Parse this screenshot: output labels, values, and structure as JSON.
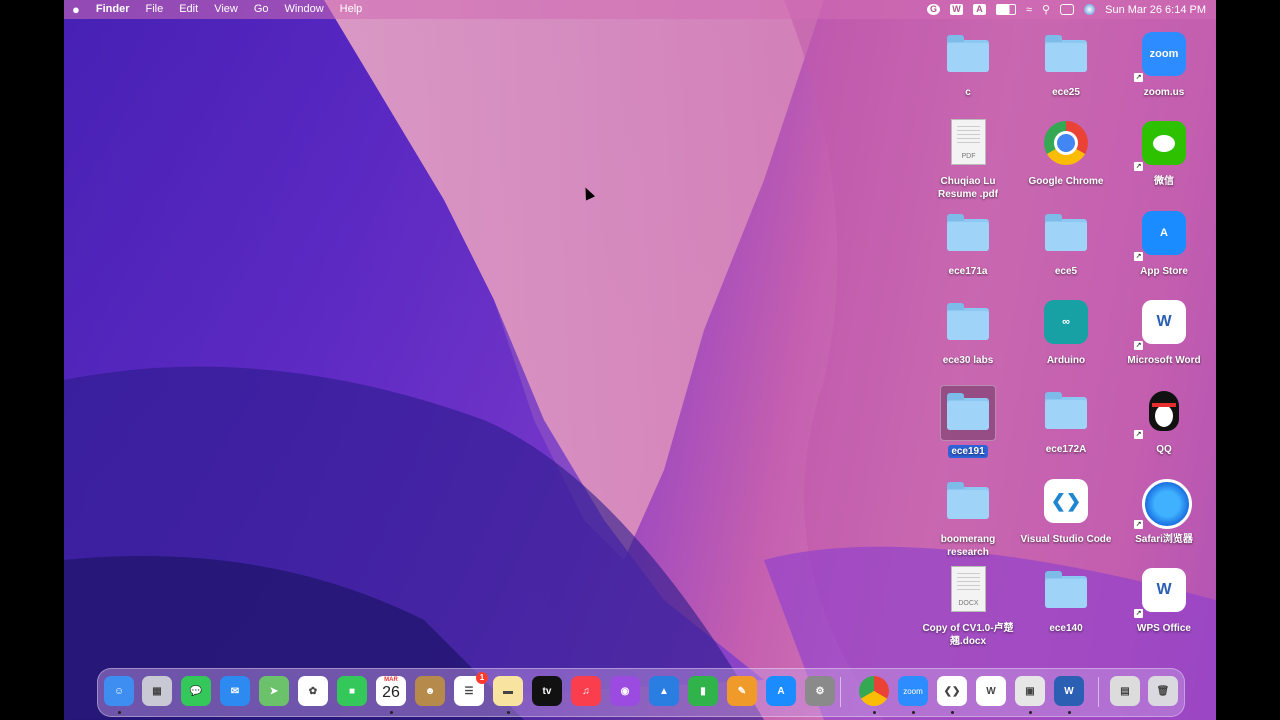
{
  "menubar": {
    "apple": "",
    "app": "Finder",
    "menus": [
      "File",
      "Edit",
      "View",
      "Go",
      "Window",
      "Help"
    ],
    "clock": "Sun Mar 26  6:14 PM"
  },
  "desktop": {
    "items": [
      {
        "label": "c",
        "kind": "folder"
      },
      {
        "label": "ece25",
        "kind": "folder"
      },
      {
        "label": "zoom.us",
        "kind": "app",
        "icon_text": "zoom",
        "color": "#2d8cff"
      },
      {
        "label": "Chuqiao Lu Resume .pdf",
        "kind": "doc",
        "ext": "PDF"
      },
      {
        "label": "Google Chrome",
        "kind": "app",
        "icon_text": "",
        "color": "#ffffff"
      },
      {
        "label": "微信",
        "kind": "app",
        "icon_text": "",
        "color": "#2dc100"
      },
      {
        "label": "ece171a",
        "kind": "folder"
      },
      {
        "label": "ece5",
        "kind": "folder"
      },
      {
        "label": "App Store",
        "kind": "app",
        "icon_text": "A",
        "color": "#1a8cff"
      },
      {
        "label": "ece30 labs",
        "kind": "folder"
      },
      {
        "label": "Arduino",
        "kind": "app",
        "icon_text": "∞",
        "color": "#17a1a5"
      },
      {
        "label": "Microsoft Word",
        "kind": "app",
        "icon_text": "W",
        "color": "#ffffff"
      },
      {
        "label": "ece191",
        "kind": "folder",
        "selected": true
      },
      {
        "label": "ece172A",
        "kind": "folder"
      },
      {
        "label": "QQ",
        "kind": "app",
        "icon_text": "",
        "color": "transparent"
      },
      {
        "label": "boomerang research",
        "kind": "folder"
      },
      {
        "label": "Visual Studio Code",
        "kind": "app",
        "icon_text": "",
        "color": "#ffffff"
      },
      {
        "label": "Safari浏览器",
        "kind": "app",
        "icon_text": "",
        "color": "#ffffff"
      },
      {
        "label": "Copy of CV1.0-卢楚翘.docx",
        "kind": "doc",
        "ext": "DOCX"
      },
      {
        "label": "ece140",
        "kind": "folder"
      },
      {
        "label": "WPS Office",
        "kind": "app",
        "icon_text": "W",
        "color": "#ffffff"
      }
    ]
  },
  "dock": {
    "calendar_month": "MAR",
    "calendar_day": "26",
    "reminders_badge": "1",
    "tv_label": "tv",
    "zoom_label": "zoom",
    "items": [
      {
        "name": "finder",
        "color": "#3d8ef0",
        "glyph": "☺",
        "running": true
      },
      {
        "name": "launchpad",
        "color": "#c9c9d6",
        "glyph": "▦",
        "running": false
      },
      {
        "name": "messages",
        "color": "#34c759",
        "glyph": "💬",
        "running": false
      },
      {
        "name": "mail",
        "color": "#2c8af0",
        "glyph": "✉",
        "running": false
      },
      {
        "name": "maps",
        "color": "#6cc26a",
        "glyph": "➤",
        "running": false
      },
      {
        "name": "photos",
        "color": "#ffffff",
        "glyph": "✿",
        "running": false
      },
      {
        "name": "facetime",
        "color": "#34c759",
        "glyph": "■",
        "running": false
      },
      {
        "name": "calendar",
        "color": "#ffffff",
        "glyph": "",
        "running": true
      },
      {
        "name": "contacts",
        "color": "#b58a4a",
        "glyph": "☻",
        "running": false
      },
      {
        "name": "reminders",
        "color": "#ffffff",
        "glyph": "☰",
        "running": false
      },
      {
        "name": "notes",
        "color": "#f8e3a0",
        "glyph": "▬",
        "running": true
      },
      {
        "name": "apple-tv",
        "color": "#111111",
        "glyph": "",
        "running": false
      },
      {
        "name": "music",
        "color": "#fa3e4e",
        "glyph": "♫",
        "running": false
      },
      {
        "name": "podcasts",
        "color": "#9b4be0",
        "glyph": "◉",
        "running": false
      },
      {
        "name": "keynote",
        "color": "#2a7de1",
        "glyph": "▲",
        "running": false
      },
      {
        "name": "numbers",
        "color": "#2fb34a",
        "glyph": "▮",
        "running": false
      },
      {
        "name": "pages",
        "color": "#f09a2a",
        "glyph": "✎",
        "running": false
      },
      {
        "name": "app-store",
        "color": "#1a8cff",
        "glyph": "A",
        "running": false
      },
      {
        "name": "system-settings",
        "color": "#8a8a8a",
        "glyph": "⚙",
        "running": false
      },
      {
        "name": "google-chrome",
        "color": "#ffffff",
        "glyph": "◎",
        "running": true
      },
      {
        "name": "zoom",
        "color": "#2d8cff",
        "glyph": "",
        "running": true
      },
      {
        "name": "visual-studio-code",
        "color": "#ffffff",
        "glyph": "❮❯",
        "running": true
      },
      {
        "name": "wps-office",
        "color": "#ffffff",
        "glyph": "W",
        "running": false
      },
      {
        "name": "preview",
        "color": "#e6e6e6",
        "glyph": "▣",
        "running": true
      },
      {
        "name": "microsoft-word",
        "color": "#2b5fb4",
        "glyph": "W",
        "running": true
      },
      {
        "name": "downloads-stack",
        "color": "#dcdcdc",
        "glyph": "▤",
        "running": false
      },
      {
        "name": "trash",
        "color": "#d9d9df",
        "glyph": "🗑",
        "running": false
      }
    ]
  },
  "colors": {
    "selection": "#2f62d6",
    "folder": "#9fd3f7"
  }
}
